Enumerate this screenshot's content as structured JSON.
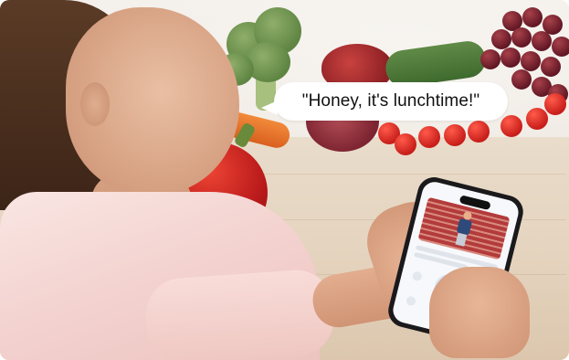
{
  "speech_bubble": {
    "text": "\"Honey, it's lunchtime!\""
  },
  "phone_screen": {
    "mic_label": "Intercom"
  },
  "colors": {
    "bubble_background": "#ffffff",
    "bubble_text": "#111111",
    "mic_accent": "#2f7de1",
    "shirt": "#f3d2cf"
  }
}
